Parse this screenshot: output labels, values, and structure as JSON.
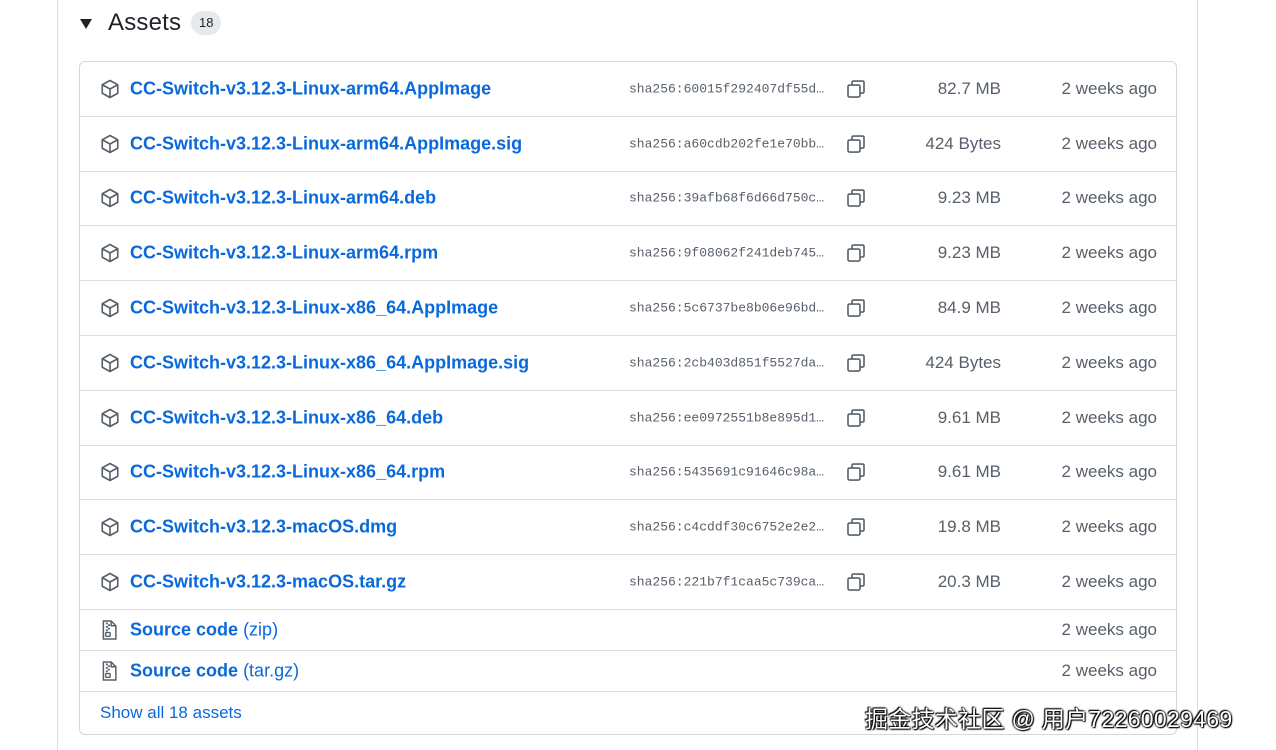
{
  "header": {
    "title": "Assets",
    "count": "18"
  },
  "assets": [
    {
      "name": "CC-Switch-v3.12.3-Linux-arm64.AppImage",
      "sha": "sha256:60015f292407df55d…",
      "size": "82.7 MB",
      "date": "2 weeks ago"
    },
    {
      "name": "CC-Switch-v3.12.3-Linux-arm64.AppImage.sig",
      "sha": "sha256:a60cdb202fe1e70bb…",
      "size": "424 Bytes",
      "date": "2 weeks ago"
    },
    {
      "name": "CC-Switch-v3.12.3-Linux-arm64.deb",
      "sha": "sha256:39afb68f6d66d750c…",
      "size": "9.23 MB",
      "date": "2 weeks ago"
    },
    {
      "name": "CC-Switch-v3.12.3-Linux-arm64.rpm",
      "sha": "sha256:9f08062f241deb745…",
      "size": "9.23 MB",
      "date": "2 weeks ago"
    },
    {
      "name": "CC-Switch-v3.12.3-Linux-x86_64.AppImage",
      "sha": "sha256:5c6737be8b06e96bd…",
      "size": "84.9 MB",
      "date": "2 weeks ago"
    },
    {
      "name": "CC-Switch-v3.12.3-Linux-x86_64.AppImage.sig",
      "sha": "sha256:2cb403d851f5527da…",
      "size": "424 Bytes",
      "date": "2 weeks ago"
    },
    {
      "name": "CC-Switch-v3.12.3-Linux-x86_64.deb",
      "sha": "sha256:ee0972551b8e895d1…",
      "size": "9.61 MB",
      "date": "2 weeks ago"
    },
    {
      "name": "CC-Switch-v3.12.3-Linux-x86_64.rpm",
      "sha": "sha256:5435691c91646c98a…",
      "size": "9.61 MB",
      "date": "2 weeks ago"
    },
    {
      "name": "CC-Switch-v3.12.3-macOS.dmg",
      "sha": "sha256:c4cddf30c6752e2e2…",
      "size": "19.8 MB",
      "date": "2 weeks ago"
    },
    {
      "name": "CC-Switch-v3.12.3-macOS.tar.gz",
      "sha": "sha256:221b7f1caa5c739ca…",
      "size": "20.3 MB",
      "date": "2 weeks ago"
    }
  ],
  "source": [
    {
      "label": "Source code",
      "format": "(zip)",
      "date": "2 weeks ago"
    },
    {
      "label": "Source code",
      "format": "(tar.gz)",
      "date": "2 weeks ago"
    }
  ],
  "show_all": "Show all 18 assets",
  "watermark": "掘金技术社区 @ 用户72260029469",
  "icons": {
    "asset": "package-icon",
    "source": "file-zip-icon",
    "copy": "copy-icon",
    "toggle": "triangle-down-icon"
  },
  "colors": {
    "link": "#0969da",
    "muted": "#57606a",
    "border": "#d0d7de",
    "counter_bg": "#e6eaef"
  }
}
